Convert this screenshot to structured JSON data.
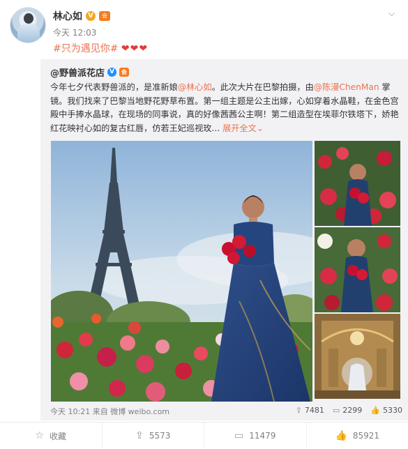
{
  "post": {
    "author": "林心如",
    "verified_badge": "V",
    "level_badge": "会",
    "time": "今天 12:03",
    "tag": "#只为遇见你#",
    "hearts": "❤❤❤"
  },
  "repost": {
    "author": "@野兽派花店",
    "verified_badge": "V",
    "level_badge": "会",
    "text_parts": {
      "p1": "今年七夕代表野兽派的，是准新娘",
      "mention1": "@林心如",
      "p2": "。此次大片在巴黎拍摄，由",
      "mention2": "@陈漫ChenMan",
      "p3": " 掌镜。我们找来了巴黎当地野花野草布置。第一组主题是公主出嫁，心如穿着水晶鞋，在金色宫殿中手捧水晶球，在现场的同事说，真的好像茜茜公主啊！第二组造型在埃菲尔铁塔下，娇艳红花映衬心如的复古红唇，仿若王妃巡视玫...",
      "more": "展开全文",
      "more_caret": "⌄"
    },
    "footer": {
      "source": "今天 10:21 来自 微博 weibo.com",
      "reposts": "7481",
      "comments": "2299",
      "likes": "5330"
    }
  },
  "actions": {
    "favorite": "收藏",
    "repost_count": "5573",
    "comment_count": "11479",
    "like_count": "85921"
  },
  "colors": {
    "accent": "#eb7350",
    "heart": "#e33b3b",
    "repost_bg": "#f2f2f5"
  }
}
